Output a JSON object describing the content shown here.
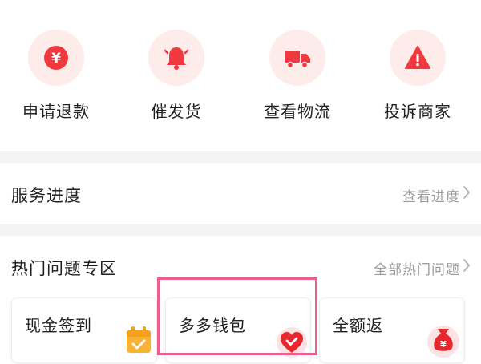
{
  "quick_actions": [
    {
      "label": "申请退款",
      "icon": "yen-coin-icon"
    },
    {
      "label": "催发货",
      "icon": "bell-icon"
    },
    {
      "label": "查看物流",
      "icon": "truck-icon"
    },
    {
      "label": "投诉商家",
      "icon": "warning-icon"
    }
  ],
  "service_progress": {
    "title": "服务进度",
    "link": "查看进度",
    "link_icon": "chevron-right-icon"
  },
  "hot_questions": {
    "title": "热门问题专区",
    "link": "全部热门问题",
    "link_icon": "chevron-right-icon",
    "cards": [
      {
        "label": "现金签到",
        "icon": "calendar-check-icon"
      },
      {
        "label": "多多钱包",
        "icon": "heart-wallet-icon",
        "highlighted": true
      },
      {
        "label": "全额返",
        "icon": "money-bag-icon"
      }
    ]
  },
  "colors": {
    "accent_red": "#f0393f",
    "icon_bg": "#fdecea",
    "calendar_orange": "#f9b234",
    "highlight_pink": "#ec5e8e",
    "muted_text": "#9a9a9a"
  }
}
